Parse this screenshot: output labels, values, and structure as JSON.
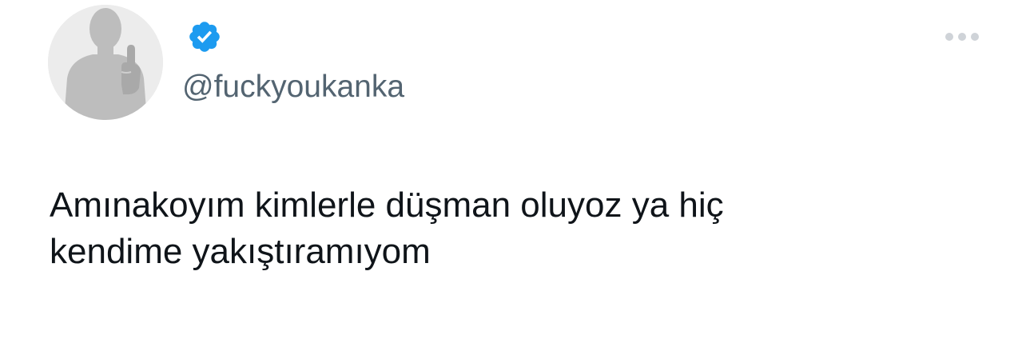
{
  "tweet": {
    "handle": "@fuckyoukanka",
    "text": "Amınakoyım kimlerle düşman oluyoz ya hiç\nkendime yakıştıramıyom",
    "verified": true,
    "avatar_icon": "default-silhouette-avatar",
    "more_icon": "more-options-ellipsis-icon"
  },
  "colors": {
    "verified_blue": "#1d9bf0",
    "handle_gray": "#536471",
    "text": "#0f1419",
    "icon_gray": "#cfd3d8"
  }
}
